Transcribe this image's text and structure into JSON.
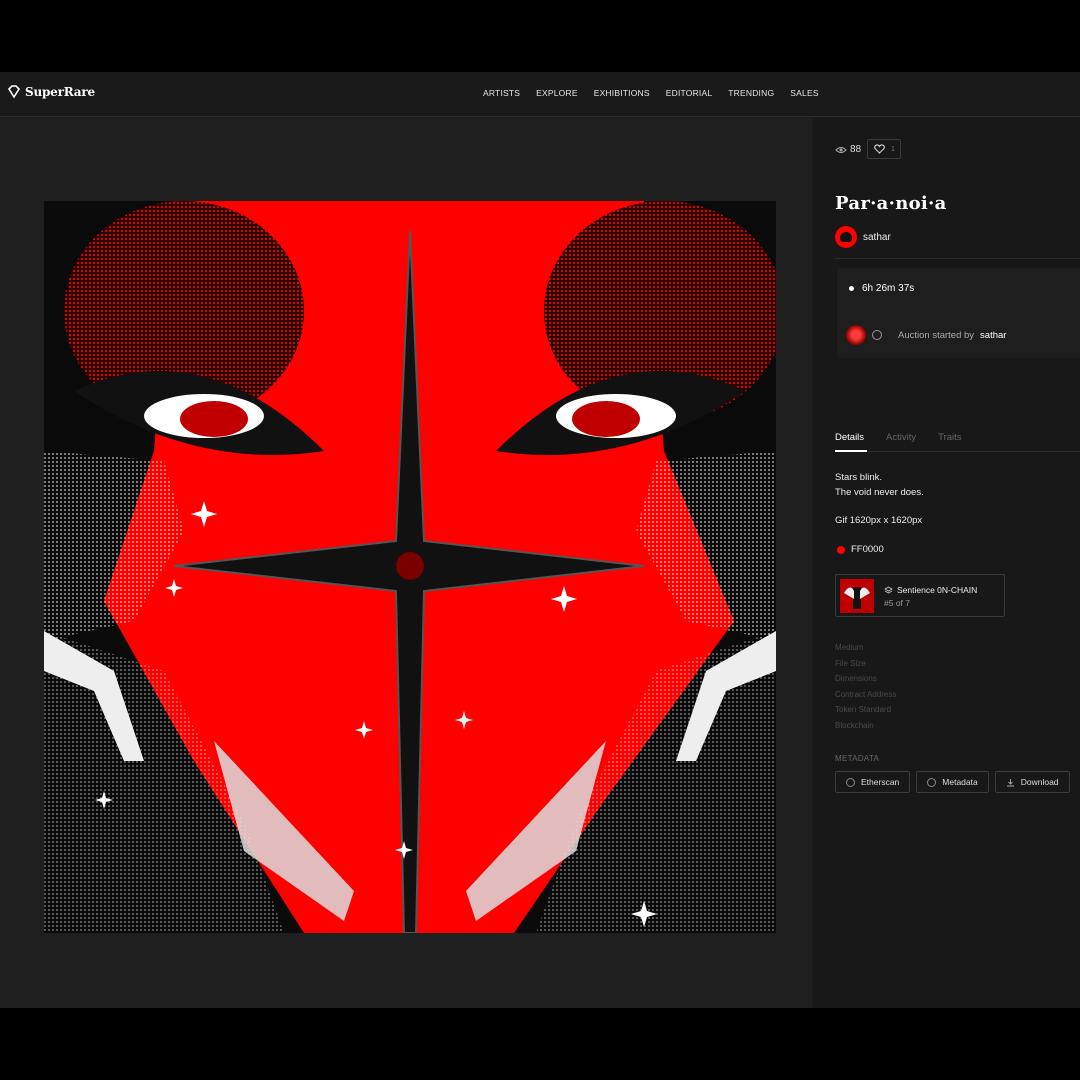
{
  "brand": {
    "name": "SuperRare"
  },
  "nav": {
    "items": [
      "ARTISTS",
      "EXPLORE",
      "EXHIBITIONS",
      "EDITORIAL",
      "TRENDING",
      "SALES"
    ]
  },
  "artwork": {
    "title": "Par·a·noi·a",
    "artist": "sathar",
    "views": "88",
    "likes": "1",
    "description_line1": "Stars blink.",
    "description_line2": "The void never does.",
    "file_spec": "Gif 1620px x 1620px",
    "color_name": "FF0000",
    "colors": {
      "accent": "#ff0000",
      "background": "#1c1c1c"
    }
  },
  "auction": {
    "timer": "6h 26m 37s",
    "started_prefix": "Auction started by",
    "started_by": "sathar"
  },
  "tabs": {
    "details": "Details",
    "activity": "Activity",
    "traits": "Traits"
  },
  "edition": {
    "name": "Sentience 0N-CHAIN",
    "number": "#5 of 7"
  },
  "properties": [
    "Medium",
    "File Size",
    "Dimensions",
    "Contract Address",
    "Token Standard",
    "Blockchain"
  ],
  "metadata": {
    "label": "METADATA",
    "buttons": [
      "Etherscan",
      "Metadata",
      "Download"
    ]
  }
}
